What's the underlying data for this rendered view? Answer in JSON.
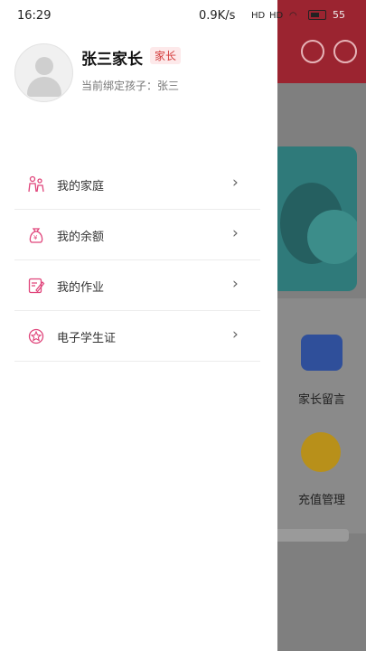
{
  "status_bar": {
    "time": "16:29",
    "network_speed": "0.9K/s",
    "signal_1": "HD",
    "signal_2": "HD",
    "battery": "55"
  },
  "profile": {
    "name": "张三家长",
    "role_badge": "家长",
    "bound_child": "当前绑定孩子：张三"
  },
  "menu": {
    "items": [
      {
        "label": "我的家庭",
        "icon": "family-icon"
      },
      {
        "label": "我的余额",
        "icon": "money-bag-icon"
      },
      {
        "label": "我的作业",
        "icon": "homework-icon"
      },
      {
        "label": "电子学生证",
        "icon": "student-id-icon"
      }
    ]
  },
  "background_app": {
    "parent_message_label": "家长留言",
    "recharge_label": "充值管理"
  },
  "colors": {
    "accent": "#d33a3a",
    "icon_pink": "#e0457b"
  }
}
